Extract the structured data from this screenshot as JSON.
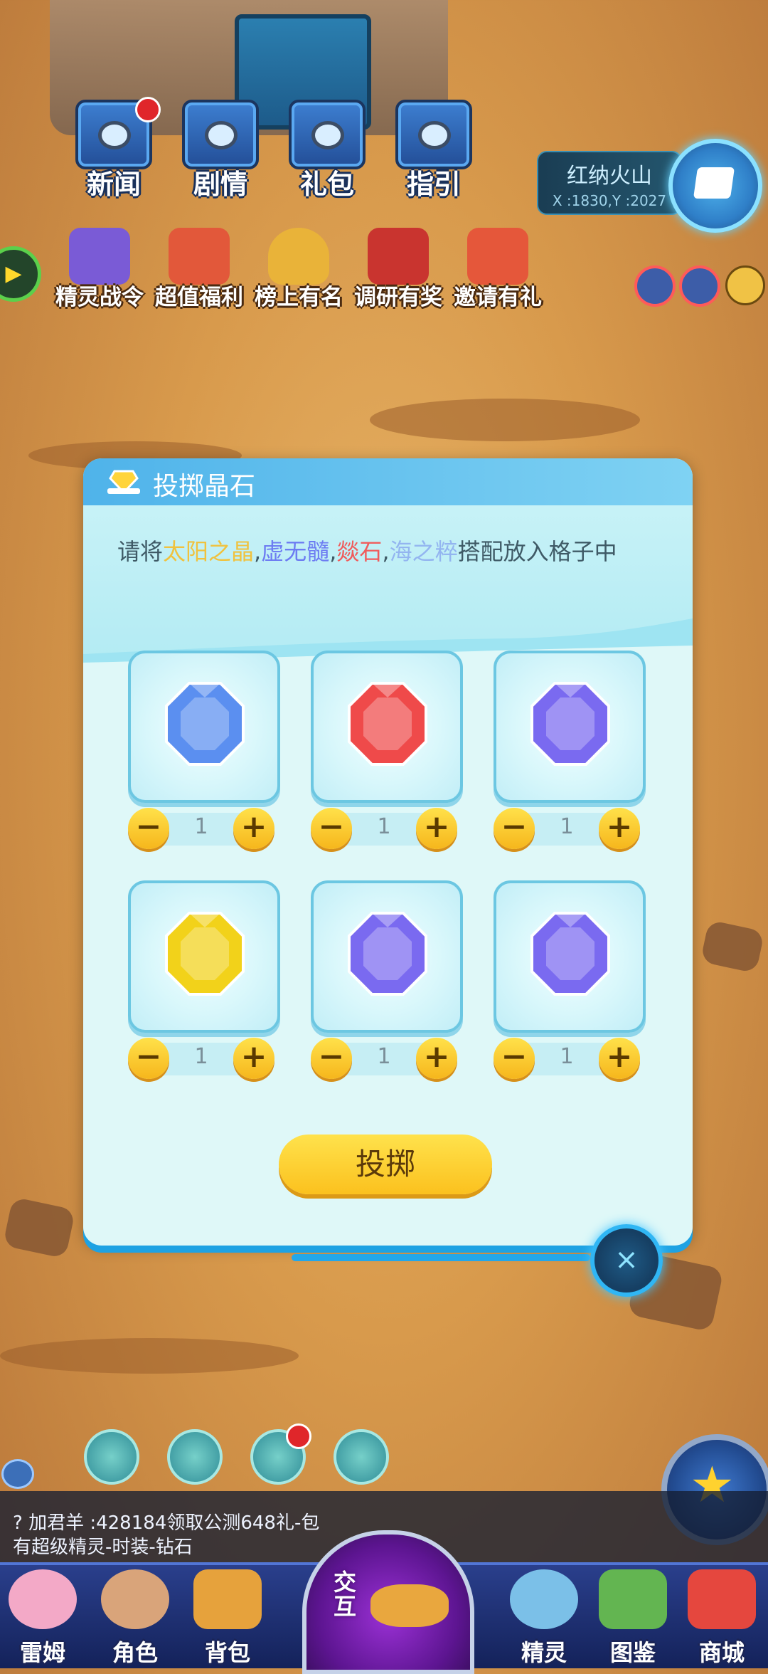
{
  "top_menu": [
    {
      "id": "news",
      "label": "新闻",
      "badge": true
    },
    {
      "id": "story",
      "label": "剧情",
      "badge": false
    },
    {
      "id": "gift",
      "label": "礼包",
      "badge": false
    },
    {
      "id": "guide",
      "label": "指引",
      "badge": false
    }
  ],
  "location": {
    "name": "红纳火山",
    "coords": "X :1830,Y :2027"
  },
  "activities": [
    {
      "id": "battle-pass",
      "label": "精灵战令",
      "color": "#7a5bd6"
    },
    {
      "id": "welfare",
      "label": "超值福利",
      "color": "#e2583a"
    },
    {
      "id": "ranking",
      "label": "榜上有名",
      "color": "#e9b339"
    },
    {
      "id": "survey",
      "label": "调研有奖",
      "color": "#c9342f"
    },
    {
      "id": "invite",
      "label": "邀请有礼",
      "color": "#e5573a"
    }
  ],
  "dialog": {
    "title": "投掷晶石",
    "instruction": {
      "prefix": "请将",
      "sun": "太阳之晶",
      "sep1": ",",
      "void": "虚无髓",
      "sep2": ",",
      "fire": "燚石",
      "sep3": ",",
      "sea": "海之粹",
      "suffix": "搭配放入格子中"
    },
    "slots": [
      {
        "gem": "blue",
        "count": "1"
      },
      {
        "gem": "red",
        "count": "1"
      },
      {
        "gem": "purple",
        "count": "1"
      },
      {
        "gem": "yellow",
        "count": "1"
      },
      {
        "gem": "purple",
        "count": "1"
      },
      {
        "gem": "purple",
        "count": "1"
      }
    ],
    "minus_symbol": "−",
    "plus_symbol": "+",
    "throw_label": "投掷",
    "close_symbol": "×"
  },
  "chat": {
    "line1": "? 加君羊 :428184领取公测648礼-包",
    "line2": "有超级精灵-时装-钻石"
  },
  "bottom_nav": {
    "leimu": "雷姆",
    "role": "角色",
    "bag": "背包",
    "interact": "交互",
    "sprite": "精灵",
    "atlas": "图鉴",
    "shop": "商城"
  },
  "colors": {
    "sun": "#f0c23e",
    "void": "#6d7cf2",
    "fire": "#f05b5b",
    "sea": "#93b5f0",
    "gem_blue": "#5b8ff0",
    "gem_red": "#ef4a4a",
    "gem_purple": "#7a6af0",
    "gem_yellow": "#f2d21a"
  }
}
